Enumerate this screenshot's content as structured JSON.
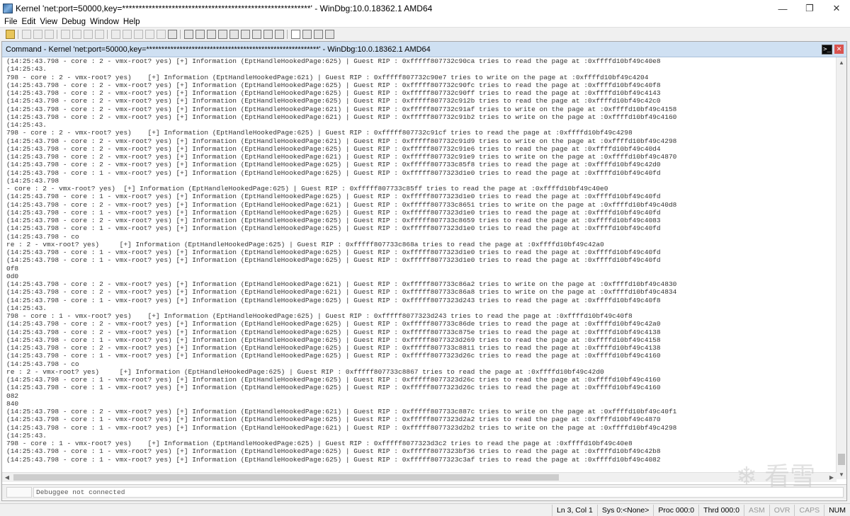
{
  "window": {
    "title": "Kernel 'net:port=50000,key=*********************************************************' - WinDbg:10.0.18362.1 AMD64",
    "controls": [
      "—",
      "❐",
      "✕"
    ]
  },
  "menu": [
    "File",
    "Edit",
    "View",
    "Debug",
    "Window",
    "Help"
  ],
  "pane": {
    "title": "Command - Kernel 'net:port=50000,key=*********************************************************' - WinDbg:10.0.18362.1 AMD64",
    "cmd_icon": ">_",
    "close": "✕"
  },
  "log_lines": [
    "(14:25:43.798 - core : 2 - vmx-root? yes) [+] Information (EptHandleHookedPage:625) | Guest RIP : 0xfffff807732c90ca tries to read the page at :0xffffd10bf49c40e8",
    "(14:25:43.",
    "798 - core : 2 - vmx-root? yes)    [+] Information (EptHandleHookedPage:621) | Guest RIP : 0xfffff807732c90e7 tries to write on the page at :0xffffd10bf49c4204",
    "(14:25:43.798 - core : 2 - vmx-root? yes) [+] Information (EptHandleHookedPage:625) | Guest RIP : 0xfffff807732c90fc tries to read the page at :0xffffd10bf49c40f8",
    "(14:25:43.798 - core : 2 - vmx-root? yes) [+] Information (EptHandleHookedPage:625) | Guest RIP : 0xfffff807732c90ff tries to read the page at :0xffffd10bf49c4143",
    "(14:25:43.798 - core : 2 - vmx-root? yes) [+] Information (EptHandleHookedPage:625) | Guest RIP : 0xfffff807732c912b tries to read the page at :0xffffd10bf49c42c0",
    "(14:25:43.798 - core : 2 - vmx-root? yes) [+] Information (EptHandleHookedPage:621) | Guest RIP : 0xfffff807732c91af tries to write on the page at :0xffffd10bf49c4158",
    "(14:25:43.798 - core : 2 - vmx-root? yes) [+] Information (EptHandleHookedPage:621) | Guest RIP : 0xfffff807732c91b2 tries to write on the page at :0xffffd10bf49c4160",
    "(14:25:43.",
    "798 - core : 2 - vmx-root? yes)    [+] Information (EptHandleHookedPage:625) | Guest RIP : 0xfffff807732c91cf tries to read the page at :0xffffd10bf49c4298",
    "(14:25:43.798 - core : 2 - vmx-root? yes) [+] Information (EptHandleHookedPage:621) | Guest RIP : 0xfffff807732c91d9 tries to write on the page at :0xffffd10bf49c4298",
    "(14:25:43.798 - core : 2 - vmx-root? yes) [+] Information (EptHandleHookedPage:625) | Guest RIP : 0xfffff807732c91e6 tries to read the page at :0xffffd10bf49c40d4",
    "(14:25:43.798 - core : 2 - vmx-root? yes) [+] Information (EptHandleHookedPage:621) | Guest RIP : 0xfffff807732c91e9 tries to write on the page at :0xffffd10bf49c4870",
    "(14:25:43.798 - core : 2 - vmx-root? yes) [+] Information (EptHandleHookedPage:625) | Guest RIP : 0xfffff807733c85f8 tries to read the page at :0xffffd10bf49c42d0",
    "(14:25:43.798 - core : 1 - vmx-root? yes) [+] Information (EptHandleHookedPage:625) | Guest RIP : 0xfffff8077323d1e0 tries to read the page at :0xffffd10bf49c40fd",
    "(14:25:43.798",
    "- core : 2 - vmx-root? yes)  [+] Information (EptHandleHookedPage:625) | Guest RIP : 0xfffff807733c85ff tries to read the page at :0xffffd10bf49c40e0",
    "(14:25:43.798 - core : 1 - vmx-root? yes) [+] Information (EptHandleHookedPage:625) | Guest RIP : 0xfffff8077323d1e0 tries to read the page at :0xffffd10bf49c40fd",
    "(14:25:43.798 - core : 2 - vmx-root? yes) [+] Information (EptHandleHookedPage:621) | Guest RIP : 0xfffff807733c8651 tries to write on the page at :0xffffd10bf49c40d8",
    "(14:25:43.798 - core : 1 - vmx-root? yes) [+] Information (EptHandleHookedPage:625) | Guest RIP : 0xfffff8077323d1e0 tries to read the page at :0xffffd10bf49c40fd",
    "(14:25:43.798 - core : 2 - vmx-root? yes) [+] Information (EptHandleHookedPage:625) | Guest RIP : 0xfffff807733c8659 tries to read the page at :0xffffd10bf49c4083",
    "(14:25:43.798 - core : 1 - vmx-root? yes) [+] Information (EptHandleHookedPage:625) | Guest RIP : 0xfffff8077323d1e0 tries to read the page at :0xffffd10bf49c40fd",
    "(14:25:43.798 - co",
    "re : 2 - vmx-root? yes)     [+] Information (EptHandleHookedPage:625) | Guest RIP : 0xfffff807733c868a tries to read the page at :0xffffd10bf49c42a0",
    "(14:25:43.798 - core : 1 - vmx-root? yes) [+] Information (EptHandleHookedPage:625) | Guest RIP : 0xfffff8077323d1e0 tries to read the page at :0xffffd10bf49c40fd",
    "(14:25:43.798 - core : 1 - vmx-root? yes) [+] Information (EptHandleHookedPage:625) | Guest RIP : 0xfffff8077323d1e0 tries to read the page at :0xffffd10bf49c40fd",
    "0f8",
    "0d0",
    "(14:25:43.798 - core : 2 - vmx-root? yes) [+] Information (EptHandleHookedPage:621) | Guest RIP : 0xfffff807733c86a2 tries to write on the page at :0xffffd10bf49c4830",
    "(14:25:43.798 - core : 2 - vmx-root? yes) [+] Information (EptHandleHookedPage:621) | Guest RIP : 0xfffff807733c86a8 tries to write on the page at :0xffffd10bf49c4834",
    "(14:25:43.798 - core : 1 - vmx-root? yes) [+] Information (EptHandleHookedPage:625) | Guest RIP : 0xfffff8077323d243 tries to read the page at :0xffffd10bf49c40f8",
    "(14:25:43.",
    "798 - core : 1 - vmx-root? yes)    [+] Information (EptHandleHookedPage:625) | Guest RIP : 0xfffff8077323d243 tries to read the page at :0xffffd10bf49c40f8",
    "(14:25:43.798 - core : 2 - vmx-root? yes) [+] Information (EptHandleHookedPage:625) | Guest RIP : 0xfffff807733c86de tries to read the page at :0xffffd10bf49c42a0",
    "(14:25:43.798 - core : 2 - vmx-root? yes) [+] Information (EptHandleHookedPage:625) | Guest RIP : 0xfffff807733c875e tries to read the page at :0xffffd10bf49c4138",
    "(14:25:43.798 - core : 1 - vmx-root? yes) [+] Information (EptHandleHookedPage:625) | Guest RIP : 0xfffff8077323d269 tries to read the page at :0xffffd10bf49c4158",
    "(14:25:43.798 - core : 2 - vmx-root? yes) [+] Information (EptHandleHookedPage:625) | Guest RIP : 0xfffff807733c8811 tries to read the page at :0xffffd10bf49c4138",
    "(14:25:43.798 - core : 1 - vmx-root? yes) [+] Information (EptHandleHookedPage:625) | Guest RIP : 0xfffff8077323d26c tries to read the page at :0xffffd10bf49c4160",
    "(14:25:43.798 - co",
    "re : 2 - vmx-root? yes)     [+] Information (EptHandleHookedPage:625) | Guest RIP : 0xfffff807733c8867 tries to read the page at :0xffffd10bf49c42d0",
    "(14:25:43.798 - core : 1 - vmx-root? yes) [+] Information (EptHandleHookedPage:625) | Guest RIP : 0xfffff8077323d26c tries to read the page at :0xffffd10bf49c4160",
    "(14:25:43.798 - core : 1 - vmx-root? yes) [+] Information (EptHandleHookedPage:625) | Guest RIP : 0xfffff8077323d26c tries to read the page at :0xffffd10bf49c4160",
    "082",
    "840",
    "(14:25:43.798 - core : 2 - vmx-root? yes) [+] Information (EptHandleHookedPage:621) | Guest RIP : 0xfffff807733c887c tries to write on the page at :0xffffd10bf49c40f1",
    "(14:25:43.798 - core : 1 - vmx-root? yes) [+] Information (EptHandleHookedPage:625) | Guest RIP : 0xfffff8077323d2a2 tries to read the page at :0xffffd10bf49c4870",
    "(14:25:43.798 - core : 1 - vmx-root? yes) [+] Information (EptHandleHookedPage:621) | Guest RIP : 0xfffff8077323d2b2 tries to write on the page at :0xffffd10bf49c4298",
    "(14:25:43.",
    "798 - core : 1 - vmx-root? yes)    [+] Information (EptHandleHookedPage:625) | Guest RIP : 0xfffff8077323d3c2 tries to read the page at :0xffffd10bf49c40e8",
    "(14:25:43.798 - core : 1 - vmx-root? yes) [+] Information (EptHandleHookedPage:625) | Guest RIP : 0xfffff8077323bf36 tries to read the page at :0xffffd10bf49c42b8",
    "(14:25:43.798 - core : 1 - vmx-root? yes) [+] Information (EptHandleHookedPage:625) | Guest RIP : 0xfffff8077323c3af tries to read the page at :0xffffd10bf49c4082"
  ],
  "command": {
    "input_text": "Debuggee not connected"
  },
  "watermark": "❄ 看雪",
  "status": {
    "position": "Ln 3, Col 1",
    "sys": "Sys 0:<None>",
    "proc": "Proc 000:0",
    "thrd": "Thrd 000:0",
    "asm": "ASM",
    "ovr": "OVR",
    "caps": "CAPS",
    "num": "NUM"
  }
}
